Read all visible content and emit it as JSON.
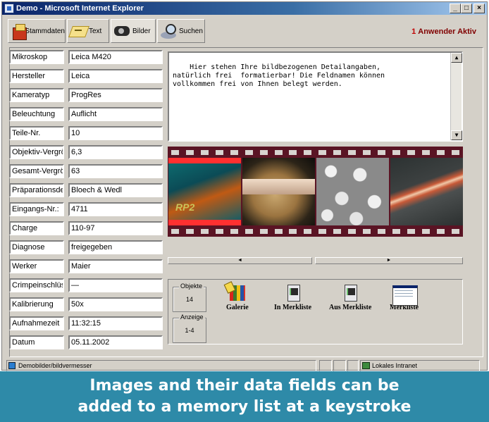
{
  "window": {
    "title": "Demo - Microsoft Internet Explorer",
    "controls": [
      "_",
      "□",
      "×"
    ]
  },
  "toolbar": {
    "tabs": [
      {
        "label": "Stammdaten",
        "icon": "cabinet-icon"
      },
      {
        "label": "Text",
        "icon": "text-icon"
      },
      {
        "label": "Bilder",
        "icon": "film-reel-icon"
      },
      {
        "label": "Suchen",
        "icon": "search-icon"
      }
    ],
    "active_tab": "Bilder",
    "user_count": "1",
    "user_status": "Anwender Aktiv"
  },
  "fields": [
    {
      "label": "Mikroskop",
      "value": "Leica M420"
    },
    {
      "label": "Hersteller",
      "value": "Leica"
    },
    {
      "label": "Kameratyp",
      "value": "ProgRes"
    },
    {
      "label": "Beleuchtung",
      "value": "Auflicht"
    },
    {
      "label": "Teile-Nr.",
      "value": "10"
    },
    {
      "label": "Objektiv-Vergrö",
      "value": "6,3"
    },
    {
      "label": "Gesamt-Vergrö",
      "value": "63"
    },
    {
      "label": "Präparationsde",
      "value": "Bloech & Wedl"
    },
    {
      "label": "Eingangs-Nr.:",
      "value": "4711"
    },
    {
      "label": "Charge",
      "value": "110-97"
    },
    {
      "label": "Diagnose",
      "value": "freigegeben"
    },
    {
      "label": "Werker",
      "value": "Maier"
    },
    {
      "label": "Crimpeinschlüs",
      "value": "—"
    },
    {
      "label": "Kalibrierung",
      "value": "50x"
    },
    {
      "label": "Aufnahmezeit",
      "value": "11:32:15"
    },
    {
      "label": "Datum",
      "value": "05.11.2002"
    }
  ],
  "details_text": "Hier stehen Ihre bildbezogenen Detailangaben,\nnatürlich frei  formatierbar! Die Feldnamen können\nvollkommen frei von Ihnen belegt werden.",
  "filmstrip": {
    "frames": [
      {
        "icon": "pcb-image",
        "text": "RP2"
      },
      {
        "icon": "wire-image"
      },
      {
        "icon": "beads-image"
      },
      {
        "icon": "fiber-image"
      }
    ],
    "selected_index": 0
  },
  "panel": {
    "objects_title": "Objekte",
    "objects_value": "14",
    "display_title": "Anzeige",
    "display_value": "1-4",
    "actions": [
      {
        "label": "Galerie",
        "icon": "gallery-icon"
      },
      {
        "label": "In Merkliste",
        "icon": "add-to-list-icon"
      },
      {
        "label": "Aus Merkliste",
        "icon": "remove-from-list-icon"
      },
      {
        "label": "Merkliste",
        "icon": "memory-list-icon"
      }
    ]
  },
  "statusbar": {
    "path": "Demobilder/bildvermesser",
    "zone": "Lokales Intranet"
  },
  "caption": {
    "line1": "Images and their data fields can be",
    "line2": "added to a memory list at a keystroke"
  }
}
